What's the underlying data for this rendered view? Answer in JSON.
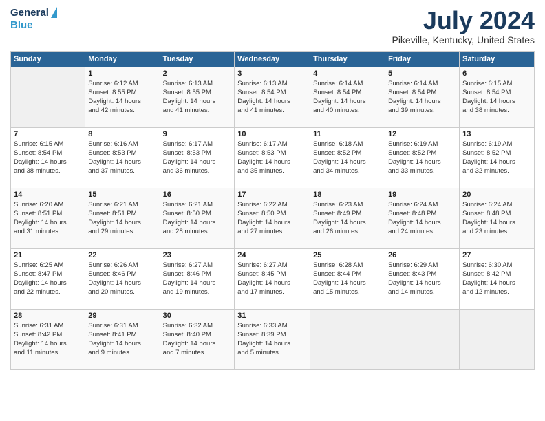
{
  "logo": {
    "line1": "General",
    "line2": "Blue"
  },
  "header": {
    "title": "July 2024",
    "subtitle": "Pikeville, Kentucky, United States"
  },
  "weekdays": [
    "Sunday",
    "Monday",
    "Tuesday",
    "Wednesday",
    "Thursday",
    "Friday",
    "Saturday"
  ],
  "weeks": [
    [
      {
        "day": "",
        "info": ""
      },
      {
        "day": "1",
        "info": "Sunrise: 6:12 AM\nSunset: 8:55 PM\nDaylight: 14 hours\nand 42 minutes."
      },
      {
        "day": "2",
        "info": "Sunrise: 6:13 AM\nSunset: 8:55 PM\nDaylight: 14 hours\nand 41 minutes."
      },
      {
        "day": "3",
        "info": "Sunrise: 6:13 AM\nSunset: 8:54 PM\nDaylight: 14 hours\nand 41 minutes."
      },
      {
        "day": "4",
        "info": "Sunrise: 6:14 AM\nSunset: 8:54 PM\nDaylight: 14 hours\nand 40 minutes."
      },
      {
        "day": "5",
        "info": "Sunrise: 6:14 AM\nSunset: 8:54 PM\nDaylight: 14 hours\nand 39 minutes."
      },
      {
        "day": "6",
        "info": "Sunrise: 6:15 AM\nSunset: 8:54 PM\nDaylight: 14 hours\nand 38 minutes."
      }
    ],
    [
      {
        "day": "7",
        "info": "Sunrise: 6:15 AM\nSunset: 8:54 PM\nDaylight: 14 hours\nand 38 minutes."
      },
      {
        "day": "8",
        "info": "Sunrise: 6:16 AM\nSunset: 8:53 PM\nDaylight: 14 hours\nand 37 minutes."
      },
      {
        "day": "9",
        "info": "Sunrise: 6:17 AM\nSunset: 8:53 PM\nDaylight: 14 hours\nand 36 minutes."
      },
      {
        "day": "10",
        "info": "Sunrise: 6:17 AM\nSunset: 8:53 PM\nDaylight: 14 hours\nand 35 minutes."
      },
      {
        "day": "11",
        "info": "Sunrise: 6:18 AM\nSunset: 8:52 PM\nDaylight: 14 hours\nand 34 minutes."
      },
      {
        "day": "12",
        "info": "Sunrise: 6:19 AM\nSunset: 8:52 PM\nDaylight: 14 hours\nand 33 minutes."
      },
      {
        "day": "13",
        "info": "Sunrise: 6:19 AM\nSunset: 8:52 PM\nDaylight: 14 hours\nand 32 minutes."
      }
    ],
    [
      {
        "day": "14",
        "info": "Sunrise: 6:20 AM\nSunset: 8:51 PM\nDaylight: 14 hours\nand 31 minutes."
      },
      {
        "day": "15",
        "info": "Sunrise: 6:21 AM\nSunset: 8:51 PM\nDaylight: 14 hours\nand 29 minutes."
      },
      {
        "day": "16",
        "info": "Sunrise: 6:21 AM\nSunset: 8:50 PM\nDaylight: 14 hours\nand 28 minutes."
      },
      {
        "day": "17",
        "info": "Sunrise: 6:22 AM\nSunset: 8:50 PM\nDaylight: 14 hours\nand 27 minutes."
      },
      {
        "day": "18",
        "info": "Sunrise: 6:23 AM\nSunset: 8:49 PM\nDaylight: 14 hours\nand 26 minutes."
      },
      {
        "day": "19",
        "info": "Sunrise: 6:24 AM\nSunset: 8:48 PM\nDaylight: 14 hours\nand 24 minutes."
      },
      {
        "day": "20",
        "info": "Sunrise: 6:24 AM\nSunset: 8:48 PM\nDaylight: 14 hours\nand 23 minutes."
      }
    ],
    [
      {
        "day": "21",
        "info": "Sunrise: 6:25 AM\nSunset: 8:47 PM\nDaylight: 14 hours\nand 22 minutes."
      },
      {
        "day": "22",
        "info": "Sunrise: 6:26 AM\nSunset: 8:46 PM\nDaylight: 14 hours\nand 20 minutes."
      },
      {
        "day": "23",
        "info": "Sunrise: 6:27 AM\nSunset: 8:46 PM\nDaylight: 14 hours\nand 19 minutes."
      },
      {
        "day": "24",
        "info": "Sunrise: 6:27 AM\nSunset: 8:45 PM\nDaylight: 14 hours\nand 17 minutes."
      },
      {
        "day": "25",
        "info": "Sunrise: 6:28 AM\nSunset: 8:44 PM\nDaylight: 14 hours\nand 15 minutes."
      },
      {
        "day": "26",
        "info": "Sunrise: 6:29 AM\nSunset: 8:43 PM\nDaylight: 14 hours\nand 14 minutes."
      },
      {
        "day": "27",
        "info": "Sunrise: 6:30 AM\nSunset: 8:42 PM\nDaylight: 14 hours\nand 12 minutes."
      }
    ],
    [
      {
        "day": "28",
        "info": "Sunrise: 6:31 AM\nSunset: 8:42 PM\nDaylight: 14 hours\nand 11 minutes."
      },
      {
        "day": "29",
        "info": "Sunrise: 6:31 AM\nSunset: 8:41 PM\nDaylight: 14 hours\nand 9 minutes."
      },
      {
        "day": "30",
        "info": "Sunrise: 6:32 AM\nSunset: 8:40 PM\nDaylight: 14 hours\nand 7 minutes."
      },
      {
        "day": "31",
        "info": "Sunrise: 6:33 AM\nSunset: 8:39 PM\nDaylight: 14 hours\nand 5 minutes."
      },
      {
        "day": "",
        "info": ""
      },
      {
        "day": "",
        "info": ""
      },
      {
        "day": "",
        "info": ""
      }
    ]
  ]
}
